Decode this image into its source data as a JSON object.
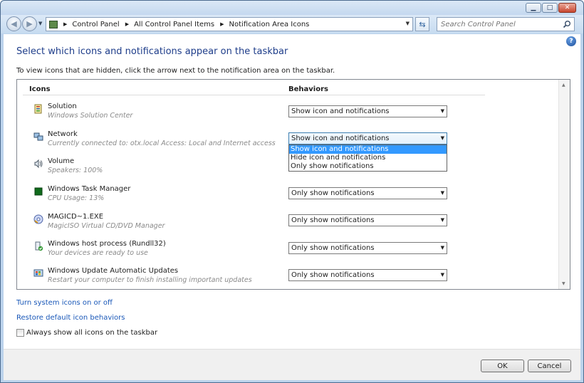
{
  "window": {
    "caption_buttons": [
      "minimize-icon",
      "maximize-icon",
      "close-icon"
    ]
  },
  "nav": {
    "breadcrumbs": [
      "Control Panel",
      "All Control Panel Items",
      "Notification Area Icons"
    ],
    "search_placeholder": "Search Control Panel"
  },
  "page": {
    "heading": "Select which icons and notifications appear on the taskbar",
    "hint": "To view icons that are hidden, click the arrow next to the notification area on the taskbar."
  },
  "columns": {
    "icons": "Icons",
    "behaviors": "Behaviors"
  },
  "rows": [
    {
      "name": "Solution",
      "desc": "Windows Solution Center",
      "behavior": "Show icon and notifications",
      "icon": "solution-center-icon"
    },
    {
      "name": "Network",
      "desc": "Currently connected to: otx.local Access:  Local and Internet access",
      "behavior": "Show icon and notifications",
      "icon": "network-icon"
    },
    {
      "name": "Volume",
      "desc": "Speakers: 100%",
      "behavior": "",
      "icon": "speaker-icon"
    },
    {
      "name": "Windows Task Manager",
      "desc": "CPU Usage: 13%",
      "behavior": "Only show notifications",
      "icon": "task-manager-icon"
    },
    {
      "name": "MAGICD~1.EXE",
      "desc": "MagicISO Virtual CD/DVD Manager",
      "behavior": "Only show notifications",
      "icon": "magiciso-icon"
    },
    {
      "name": "Windows host process (Rundll32)",
      "desc": "Your devices are ready to use",
      "behavior": "Only show notifications",
      "icon": "device-icon"
    },
    {
      "name": "Windows Update Automatic Updates",
      "desc": "Restart your computer to finish installing important updates",
      "behavior": "Only show notifications",
      "icon": "windows-update-icon"
    }
  ],
  "dropdown_options": [
    "Show icon and notifications",
    "Hide icon and notifications",
    "Only show notifications"
  ],
  "links": {
    "system_icons": "Turn system icons on or off",
    "restore": "Restore default icon behaviors"
  },
  "checkbox": {
    "label": "Always show all icons on the taskbar",
    "checked": false
  },
  "buttons": {
    "ok": "OK",
    "cancel": "Cancel"
  },
  "colors": {
    "heading": "#1e3d8a",
    "link": "#1a58b8",
    "selection": "#3399ff"
  }
}
